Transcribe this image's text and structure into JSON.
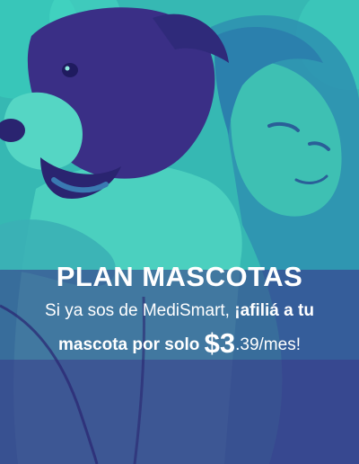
{
  "banner": {
    "title": "PLAN MASCOTAS",
    "subtitle_regular": "Si ya sos de MediSmart,",
    "subtitle_bold": " ¡afiliá a tu",
    "line2_bold": "mascota por solo ",
    "price_main": "$3",
    "price_rest": ".39/mes!"
  },
  "colors": {
    "teal": "#39c7b6",
    "purple": "#3d2f87",
    "text": "#ffffff"
  }
}
